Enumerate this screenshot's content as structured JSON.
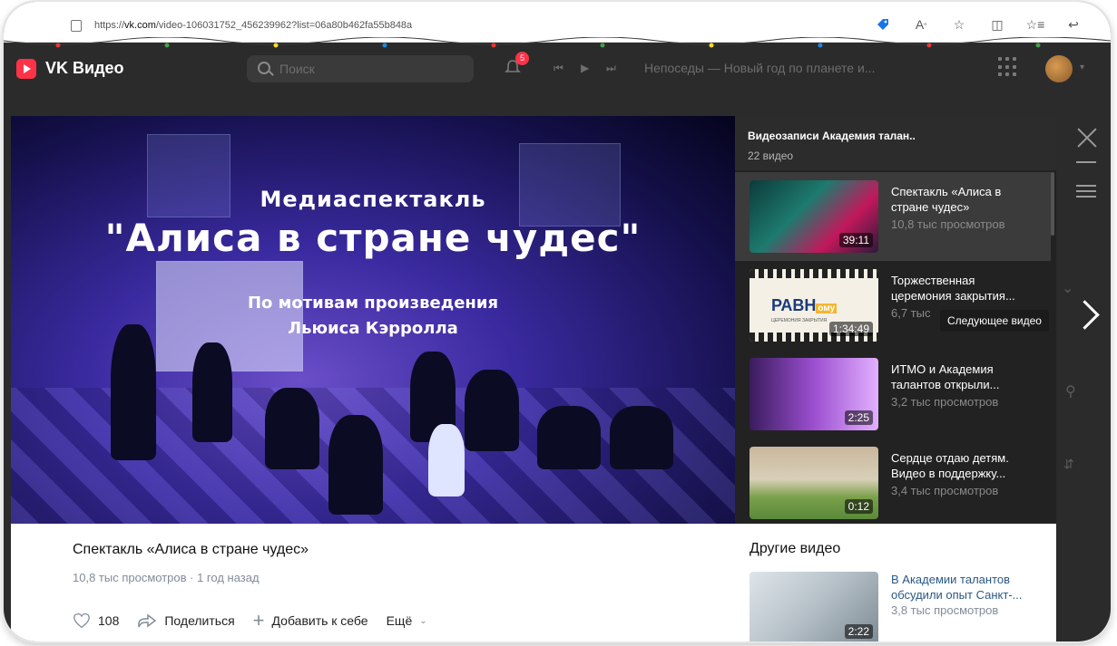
{
  "browser": {
    "url_prefix": "https://",
    "url_domain": "vk.com",
    "url_rest": "/video-106031752_456239962?list=06a80b462fa55b848a"
  },
  "header": {
    "brand": "VK Видео",
    "search_placeholder": "Поиск",
    "notification_count": "5",
    "now_playing": "Непоседы — Новый год по планете и..."
  },
  "video": {
    "overlay_line1": "Медиаспектакль",
    "overlay_line2": "\"Алиса в стране чудес\"",
    "overlay_line3": "По мотивам произведения",
    "overlay_line4": "Льюиса Кэрролла",
    "title": "Спектакль «Алиса в стране чудес»",
    "meta": "10,8 тыс просмотров · 1 год назад",
    "likes": "108",
    "share_label": "Поделиться",
    "add_label": "Добавить к себе",
    "more_label": "Ещё"
  },
  "playlist": {
    "title": "Видеозаписи Академия талан..",
    "count": "22 видео",
    "items": [
      {
        "name": "Спектакль «Алиса в стране чудес»",
        "views": "10,8 тыс просмотров",
        "duration": "39:11"
      },
      {
        "name": "Торжественная церемония закрытия...",
        "views": "6,7 тыс",
        "duration": "1:34:49"
      },
      {
        "name": "ИТМО и Академия талантов открыли...",
        "views": "3,2 тыс просмотров",
        "duration": "2:25"
      },
      {
        "name": "Сердце отдаю детям. Видео в поддержку...",
        "views": "3,4 тыс просмотров",
        "duration": "0:12"
      }
    ]
  },
  "tooltip": "Следующее видео",
  "other": {
    "heading": "Другие видео",
    "item": {
      "name": "В Академии талантов обсудили опыт Санкт-...",
      "views": "3,8 тыс просмотров",
      "duration": "2:22"
    }
  },
  "thumb2_logo": "РАВН",
  "thumb2_logo_tail": "ому",
  "thumb2_caption": "ЦЕРЕМОНИЯ ЗАКРЫТИЯ",
  "colors": {
    "accent": "#ff3347",
    "link": "#2a5885",
    "meta": "#818c99"
  }
}
